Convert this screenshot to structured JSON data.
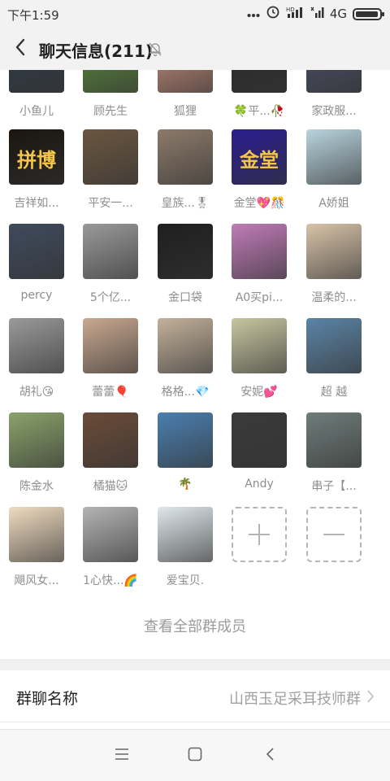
{
  "status_bar": {
    "time": "下午1:59",
    "network": "4G",
    "icons": [
      "more-dots-icon",
      "alarm-icon",
      "hd-signal-icon",
      "signal-icon",
      "battery-icon"
    ]
  },
  "header": {
    "title": "聊天信息(211)",
    "back_icon": "chevron-left-icon",
    "mute_icon": "bell-off-icon"
  },
  "members": [
    {
      "name": "小鱼儿",
      "avatar": "dark suit portrait",
      "color": "#2f3a46"
    },
    {
      "name": "顾先生",
      "avatar": "green field",
      "color": "#5b8a3c"
    },
    {
      "name": "狐狸",
      "avatar": "portrait",
      "color": "#c98f7c"
    },
    {
      "name": "🍀平...🥀",
      "avatar": "dark portrait",
      "color": "#2b2b2b"
    },
    {
      "name": "家政服...",
      "avatar": "portrait",
      "color": "#4a4f63"
    },
    {
      "name": "吉祥如...",
      "avatar_text": "拼博",
      "avatar": "gold calligraphy on black",
      "color": "#1a1510"
    },
    {
      "name": "平安一...",
      "avatar": "man in suit",
      "color": "#6b5640"
    },
    {
      "name": "皇族...🎖",
      "avatar": "man in suit",
      "color": "#8c7a6a"
    },
    {
      "name": "金堂💖🎊",
      "avatar_text": "金堂",
      "avatar": "gold text on blue",
      "color": "#2a1d8f"
    },
    {
      "name": "A娇姐",
      "avatar": "woman in red dress",
      "color": "#b8d4de"
    },
    {
      "name": "percy",
      "avatar": "man in suit",
      "color": "#3e4a5c"
    },
    {
      "name": "5个亿...",
      "avatar": "person with cap",
      "color": "#9a9a9a"
    },
    {
      "name": "金口袋",
      "avatar": "man with glasses",
      "color": "#1f1f1f"
    },
    {
      "name": "A0买pi...",
      "avatar": "woman in purple ring",
      "color": "#c07bb8"
    },
    {
      "name": "温柔的...",
      "avatar": "woman",
      "color": "#d8c3a8"
    },
    {
      "name": "胡礼😘",
      "avatar": "woman",
      "color": "#9a9a9a"
    },
    {
      "name": "蕾蕾🎈",
      "avatar": "woman",
      "color": "#c9a88f"
    },
    {
      "name": "格格...💎",
      "avatar": "woman",
      "color": "#c3b19a"
    },
    {
      "name": "安妮💕",
      "avatar": "woman",
      "color": "#c8c6a0"
    },
    {
      "name": "超 越",
      "avatar": "city skyline",
      "color": "#5b84a6"
    },
    {
      "name": "陈金水",
      "avatar": "white and pink roses",
      "color": "#8aa36a"
    },
    {
      "name": "橘猫🐱",
      "avatar": "dumplings",
      "color": "#6b4b38"
    },
    {
      "name": "🌴",
      "avatar": "sky and sea",
      "color": "#4a7fb0"
    },
    {
      "name": "Andy",
      "avatar": "woman",
      "color": "#3a3a3a"
    },
    {
      "name": "串子【...",
      "avatar": "woman",
      "color": "#6f7d7a"
    },
    {
      "name": "飓风女...",
      "avatar": "sketch illustration",
      "color": "#f0dcc0"
    },
    {
      "name": "1心快...🌈",
      "avatar": "woman",
      "color": "#b4b4b4"
    },
    {
      "name": "爱宝贝.",
      "avatar": "placeholder image",
      "color": "#dfe8ec"
    }
  ],
  "actions": {
    "add_icon": "plus-icon",
    "remove_icon": "minus-icon"
  },
  "view_all_label": "查看全部群成员",
  "group_name": {
    "label": "群聊名称",
    "value": "山西玉足采耳技师群"
  },
  "nav": {
    "icons": [
      "menu-icon",
      "home-square-icon",
      "back-triangle-icon"
    ]
  }
}
